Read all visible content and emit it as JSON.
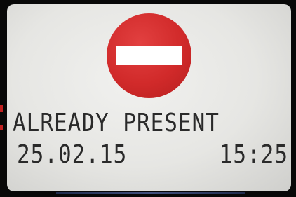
{
  "display": {
    "status_message": "ALREADY PRESENT",
    "date": "25.02.15",
    "time": "15:25",
    "icon": "no-entry-icon",
    "icon_color": "#d12a2a"
  }
}
